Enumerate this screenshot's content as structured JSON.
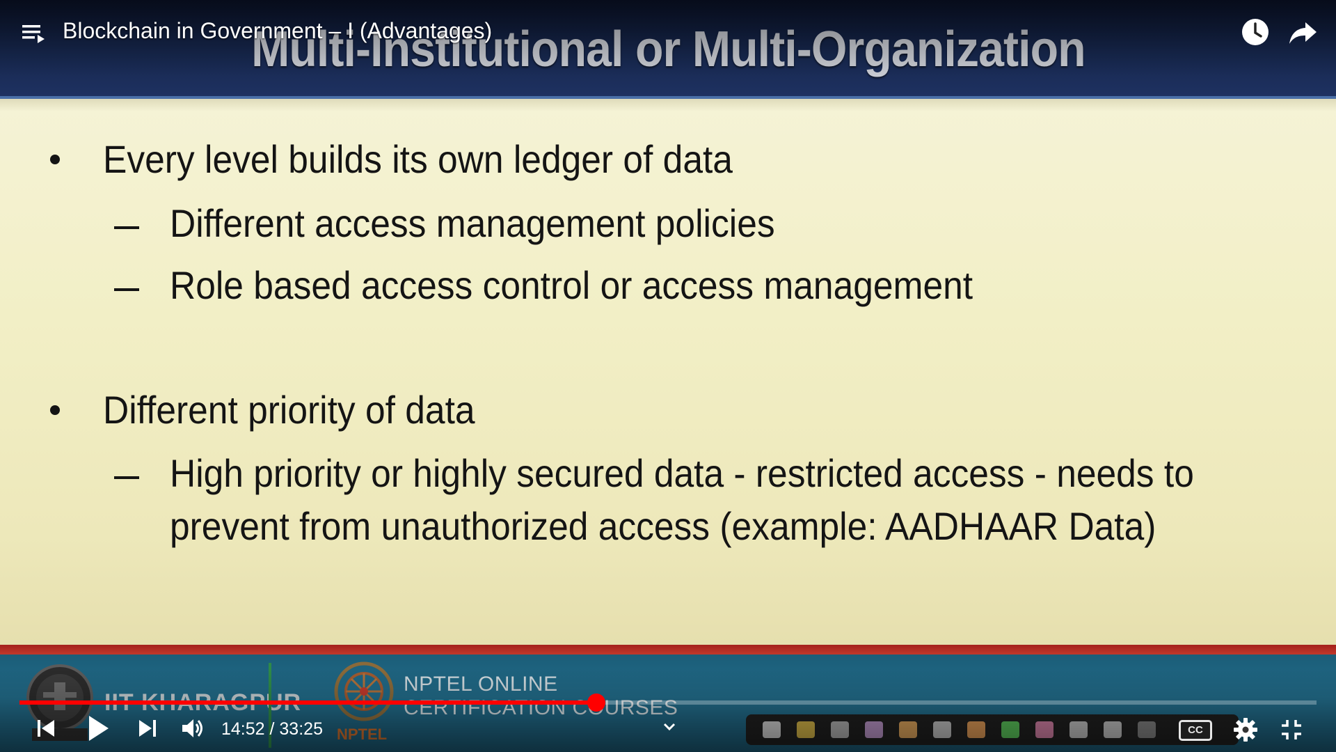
{
  "player": {
    "video_title": "Blockchain in Government – I (Advantages)",
    "current_time": "14:52",
    "duration": "33:25",
    "time_separator": " / ",
    "progress_fraction": 0.445,
    "icons": {
      "playlist": "playlist-icon",
      "watch_later": "clock-icon",
      "share": "share-arrow-icon",
      "previous": "skip-previous-icon",
      "play": "play-icon",
      "next": "skip-next-icon",
      "volume": "volume-icon",
      "chapters": "chevron-down-icon",
      "captions": "cc-icon",
      "settings": "gear-icon",
      "exit_fullscreen": "exit-fullscreen-icon"
    },
    "captions_label": "CC",
    "colors": {
      "progress_played": "#ff0000",
      "progress_track": "rgba(255,255,255,0.28)"
    }
  },
  "slide": {
    "title": "Multi-Institutional or Multi-Organization",
    "bullets": [
      {
        "text": "Every level builds its own ledger of data",
        "subs": [
          "Different access management policies",
          "Role based access control or access management"
        ]
      },
      {
        "text": "Different priority of data",
        "subs": [
          "High priority or highly secured data - restricted access - needs to prevent from unauthorized access (example: AADHAAR Data)"
        ]
      }
    ],
    "sub_lines_second": [
      "High priority or highly secured data - restricted access - needs to",
      "prevent from unauthorized access (example: AADHAAR Data)"
    ],
    "colors": {
      "header_bg": "#17284f",
      "body_bg": "#f2efc6",
      "red_band": "#b22a22",
      "footer_bg": "#226c8a"
    }
  },
  "footer_branding": {
    "left_institute": "IIT KHARAGPUR",
    "program_line1": "NPTEL ONLINE",
    "program_line2": "CERTIFICATION COURSES",
    "logo_label": "NPTEL"
  },
  "annotation_toolbar": {
    "tools": [
      {
        "icon": "pointer-flag-icon",
        "color": "#e0e0e0"
      },
      {
        "icon": "folder-icon",
        "color": "#e6c34a"
      },
      {
        "icon": "eraser-icon",
        "color": "#bdbdbd"
      },
      {
        "icon": "pen-icon",
        "color": "#c9a0d8"
      },
      {
        "icon": "highlighter-icon",
        "color": "#f0b060"
      },
      {
        "icon": "whiteboard-icon",
        "color": "#cfcfcf"
      },
      {
        "icon": "marker-orange-icon",
        "color": "#f2a65a"
      },
      {
        "icon": "marker-green-icon",
        "color": "#5fd35f"
      },
      {
        "icon": "marker-pink-icon",
        "color": "#e58ab3"
      },
      {
        "icon": "cursor-icon",
        "color": "#d0d0d0"
      },
      {
        "icon": "laser-icon",
        "color": "#d0d0d0"
      },
      {
        "icon": "blank-slide-icon",
        "color": "#8a8a8a"
      }
    ]
  }
}
